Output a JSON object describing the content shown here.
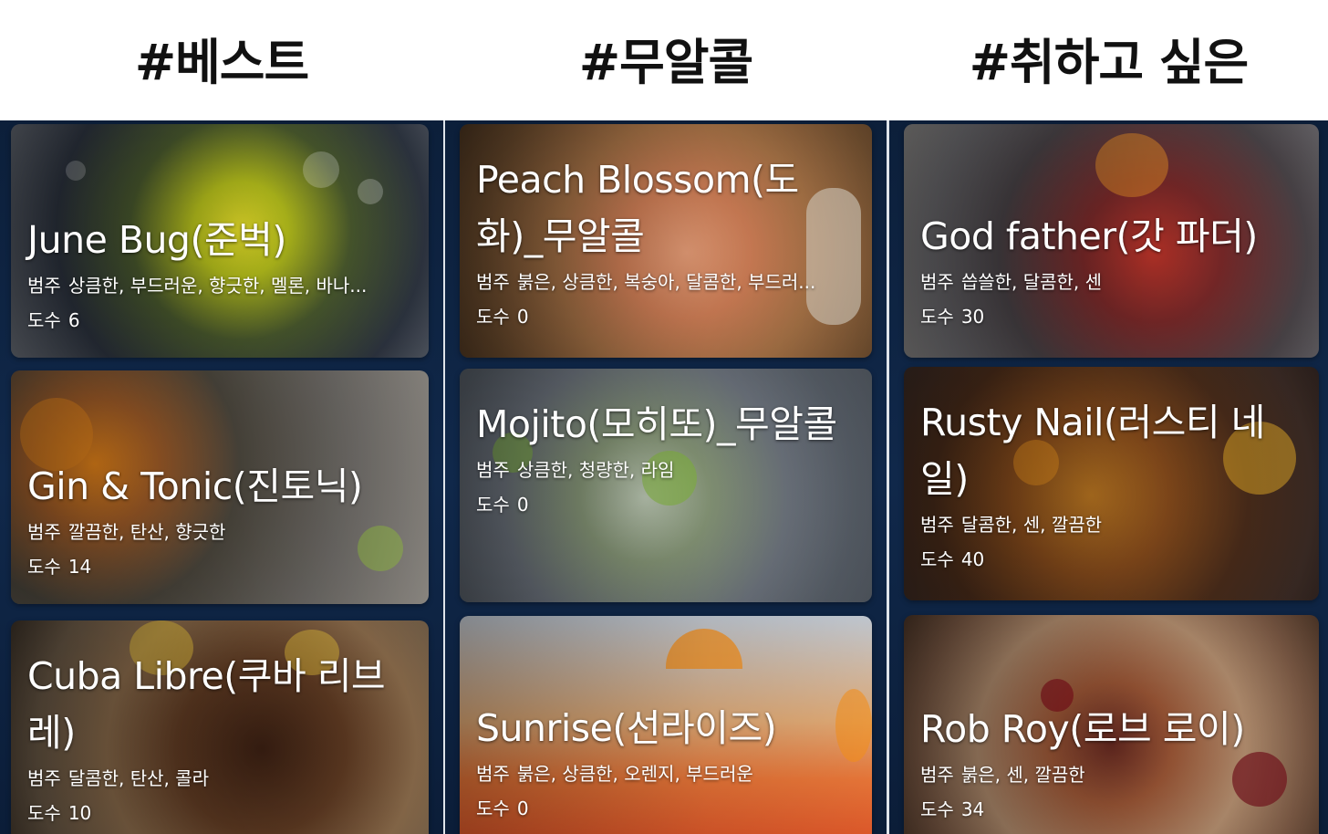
{
  "columns": [
    {
      "heading": "#베스트",
      "cards": [
        {
          "name": "June Bug(준벅)",
          "tags_label": "범주",
          "tags": "상큼한, 부드러운, 향긋한, 멜론, 바나...",
          "abv_label": "도수",
          "abv": "6"
        },
        {
          "name": "Gin & Tonic(진토닉)",
          "tags_label": "범주",
          "tags": "깔끔한, 탄산, 향긋한",
          "abv_label": "도수",
          "abv": "14"
        },
        {
          "name": "Cuba Libre(쿠바 리브레)",
          "tags_label": "범주",
          "tags": "달콤한, 탄산, 콜라",
          "abv_label": "도수",
          "abv": "10"
        }
      ]
    },
    {
      "heading": "#무알콜",
      "cards": [
        {
          "name": "Peach Blossom(도화)_무알콜",
          "tags_label": "범주",
          "tags": "붉은, 상큼한, 복숭아, 달콤한, 부드러...",
          "abv_label": "도수",
          "abv": "0"
        },
        {
          "name": "Mojito(모히또)_무알콜",
          "tags_label": "범주",
          "tags": "상큼한, 청량한, 라임",
          "abv_label": "도수",
          "abv": "0"
        },
        {
          "name": "Sunrise(선라이즈)",
          "tags_label": "범주",
          "tags": "붉은, 상큼한, 오렌지, 부드러운",
          "abv_label": "도수",
          "abv": "0"
        }
      ]
    },
    {
      "heading": "#취하고 싶은",
      "cards": [
        {
          "name": "God father(갓 파더)",
          "tags_label": "범주",
          "tags": "씁쓸한, 달콤한, 센",
          "abv_label": "도수",
          "abv": "30"
        },
        {
          "name": "Rusty Nail(러스티 네일)",
          "tags_label": "범주",
          "tags": "달콤한, 센, 깔끔한",
          "abv_label": "도수",
          "abv": "40"
        },
        {
          "name": "Rob Roy(로브 로이)",
          "tags_label": "범주",
          "tags": "붉은, 센, 깔끔한",
          "abv_label": "도수",
          "abv": "34"
        }
      ]
    }
  ]
}
